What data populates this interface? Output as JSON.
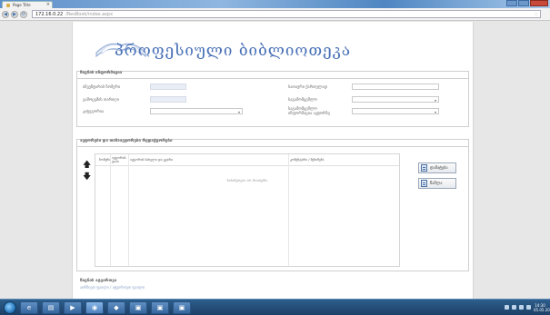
{
  "browser": {
    "tab_title": "Page Title",
    "tab_close": "×",
    "address_host": "172.16.0.22",
    "address_path": "/ResBook/index.aspx",
    "back_icon": "◀",
    "forward_icon": "▶",
    "reload_icon": "⟳",
    "star_icon": "☆"
  },
  "app": {
    "title": "პროფესიული ბიბლიოთეკა"
  },
  "book_section": {
    "title": "წიგნის ინფორმაცია",
    "left_fields": [
      {
        "label": "ინვენტარის ნომერი",
        "value": ""
      },
      {
        "label": "გამოცემის თარიღი",
        "value": ""
      },
      {
        "label": "კატეგორია",
        "value": ""
      }
    ],
    "right_fields": [
      {
        "label": "სათაური ქართულად",
        "value": ""
      },
      {
        "label": "გამომცემლობა",
        "value": ""
      },
      {
        "label": "ენა",
        "value": ""
      },
      {
        "label": "ავტორი",
        "value": ""
      }
    ],
    "right_labels": [
      "სათაური ქართულად",
      "საგამომცემლო",
      "საგამომცემლო",
      "ინფორმაცია ავტორზე"
    ]
  },
  "authors_section": {
    "title": "ავტორები და თანაავტორები რედაქტორები",
    "columns": [
      "ნომერი",
      "ავტორის ტიპი",
      "ავტორის სახელი და გვარი",
      "კომენტარი / შენიშვნა"
    ],
    "empty_text": "ჩანაწერები არ მოიძებნა",
    "move_up_icon": "🡅",
    "move_down_icon": "🡇",
    "add_label": "დამატება",
    "delete_label": "წაშლა"
  },
  "footer_section": {
    "title": "წიგნის ატვირთვა",
    "subtitle": "აირჩიეთ ფაილი / ატვირთეთ ფაილი"
  },
  "taskbar": {
    "clock_time": "14:30",
    "clock_date": "05.05.2014"
  },
  "colors": {
    "accent": "#4a72b7",
    "titlebar": "#5b8fc9",
    "taskbar": "#1d3f66"
  }
}
